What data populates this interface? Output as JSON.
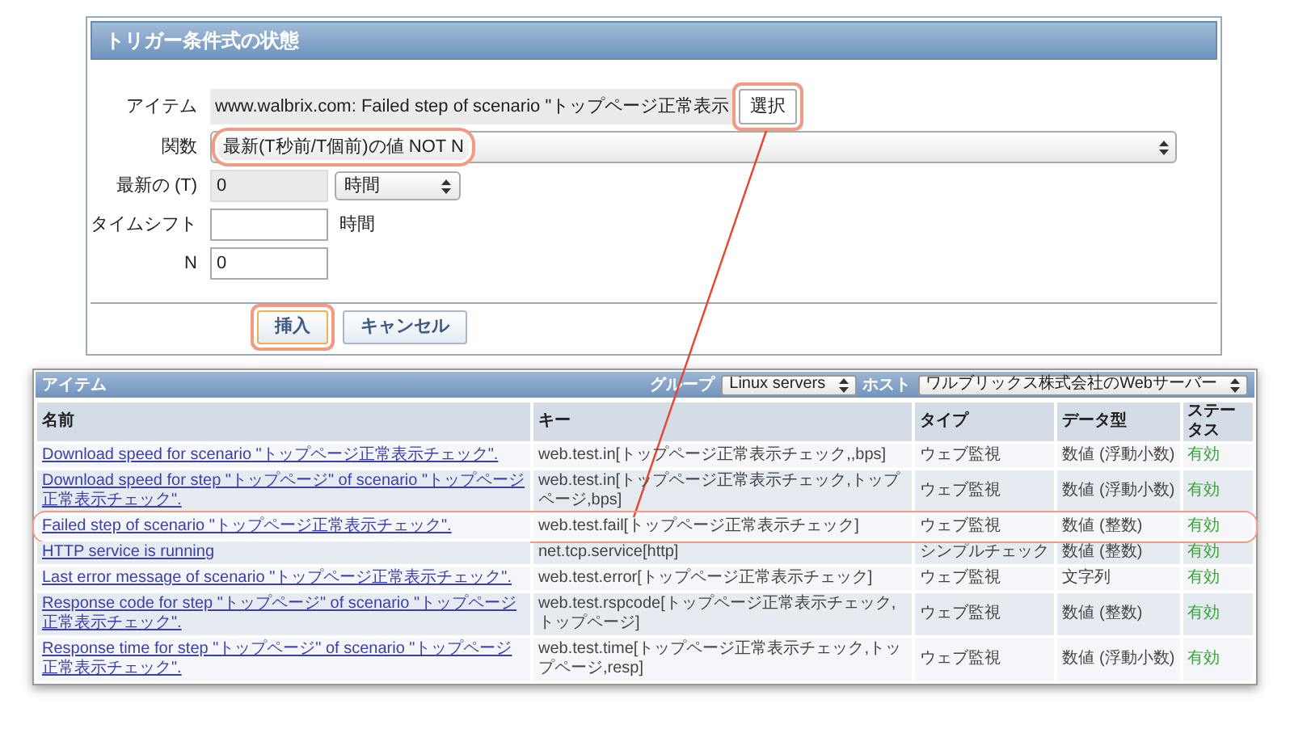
{
  "form": {
    "title": "トリガー条件式の状態",
    "fields": [
      {
        "kind": "item",
        "label": "アイテム",
        "value": "www.walbrix.com: Failed step of scenario \"トップページ正常表示",
        "button": {
          "label": "選択",
          "highlighted": true
        }
      },
      {
        "kind": "select",
        "label": "関数",
        "value": "最新(T秒前/T個前)の値 NOT N",
        "highlighted": true
      },
      {
        "kind": "number_unit",
        "label": "最新の (T)",
        "value": "0",
        "disabled": true,
        "unit": "時間"
      },
      {
        "kind": "text_unit",
        "label": "タイムシフト",
        "unit": "時間"
      },
      {
        "kind": "text",
        "label": "N",
        "value": "0"
      }
    ],
    "buttons": [
      {
        "label": "挿入",
        "highlighted": true
      },
      {
        "label": "キャンセル",
        "highlighted": false
      }
    ]
  },
  "items_table": {
    "title": "アイテム",
    "filters": [
      {
        "label": "グループ",
        "value": "Linux servers"
      },
      {
        "label": "ホスト",
        "value": "ワルブリックス株式会社のWebサーバー"
      }
    ],
    "columns": [
      "名前",
      "キー",
      "タイプ",
      "データ型",
      "ステータス"
    ],
    "rows": [
      {
        "name": "Download speed for scenario \"トップページ正常表示チェック\".",
        "key": "web.test.in[トップページ正常表示チェック,,bps]",
        "type": "ウェブ監視",
        "data_type": "数値 (浮動小数)",
        "status": "有効",
        "enabled": true,
        "highlighted": false
      },
      {
        "name": "Download speed for step \"トップページ\" of scenario \"トップページ正常表示チェック\".",
        "key": "web.test.in[トップページ正常表示チェック,トップページ,bps]",
        "type": "ウェブ監視",
        "data_type": "数値 (浮動小数)",
        "status": "有効",
        "enabled": true,
        "highlighted": false
      },
      {
        "name": "Failed step of scenario \"トップページ正常表示チェック\".",
        "key": "web.test.fail[トップページ正常表示チェック]",
        "type": "ウェブ監視",
        "data_type": "数値 (整数)",
        "status": "有効",
        "enabled": true,
        "highlighted": true
      },
      {
        "name": "HTTP service is running",
        "key": "net.tcp.service[http]",
        "type": "シンプルチェック",
        "data_type": "数値 (整数)",
        "status": "有効",
        "enabled": true,
        "highlighted": false
      },
      {
        "name": "Last error message of scenario \"トップページ正常表示チェック\".",
        "key": "web.test.error[トップページ正常表示チェック]",
        "type": "ウェブ監視",
        "data_type": "文字列",
        "status": "有効",
        "enabled": true,
        "highlighted": false
      },
      {
        "name": "Response code for step \"トップページ\" of scenario \"トップページ正常表示チェック\".",
        "key": "web.test.rspcode[トップページ正常表示チェック,トップページ]",
        "type": "ウェブ監視",
        "data_type": "数値 (整数)",
        "status": "有効",
        "enabled": true,
        "highlighted": false
      },
      {
        "name": "Response time for step \"トップページ\" of scenario \"トップページ正常表示チェック\".",
        "key": "web.test.time[トップページ正常表示チェック,トップページ,resp]",
        "type": "ウェブ監視",
        "data_type": "数値 (浮動小数)",
        "status": "有効",
        "enabled": true,
        "highlighted": false
      }
    ]
  }
}
